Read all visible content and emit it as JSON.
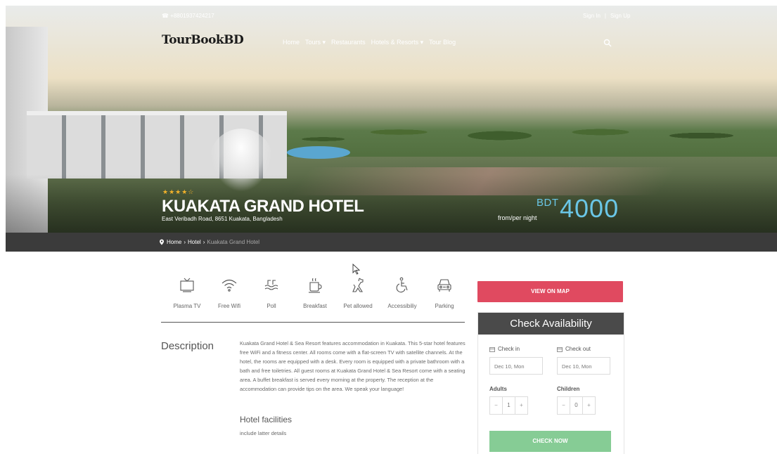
{
  "header": {
    "phone": "☎ +8801937424217",
    "sign_in": "Sign In",
    "separator": "|",
    "sign_up": "Sign Up",
    "brand": "TourBookBD",
    "nav": [
      "Home",
      "Tours ▾",
      "Restaurants",
      "Hotels & Resorts ▾",
      "Tour Blog"
    ]
  },
  "hotel": {
    "stars": "★★★★☆",
    "rating": 4,
    "name": "KUAKATA GRAND HOTEL",
    "address": "East Veribadh Road, 8651 Kuakata, Bangladesh",
    "price_label": "from/per night",
    "currency": "BDT",
    "price": "4000"
  },
  "breadcrumb": {
    "home": "Home",
    "sep": "›",
    "hotel": "Hotel",
    "current": "Kuakata Grand Hotel"
  },
  "amenities": [
    {
      "label": "Plasma TV",
      "icon": "tv-icon"
    },
    {
      "label": "Free Wifi",
      "icon": "wifi-icon"
    },
    {
      "label": "Poll",
      "icon": "pool-icon"
    },
    {
      "label": "Breakfast",
      "icon": "coffee-icon"
    },
    {
      "label": "Pet allowed",
      "icon": "dog-icon"
    },
    {
      "label": "Accessibiliy",
      "icon": "wheelchair-icon"
    },
    {
      "label": "Parking",
      "icon": "car-icon"
    }
  ],
  "description": {
    "heading": "Description",
    "text": "Kuakata Grand Hotel & Sea Resort features accommodation in Kuakata. This 5-star hotel features free WiFi and a fitness center. All rooms come with a flat-screen TV with satellite channels. At the hotel, the rooms are equipped with a desk. Every room is equipped with a private bathroom with a bath and free toiletries. All guest rooms at Kuakata Grand Hotel & Sea Resort come with a seating area. A buffet breakfast is served every morning at the property. The reception at the accommodation can provide tips on the area. We speak your language!",
    "facilities_heading": "Hotel facilities",
    "facilities_text": "include latter details"
  },
  "sidebar": {
    "map_button": "VIEW ON MAP",
    "availability_title": "Check Availability",
    "check_in_label": "Check in",
    "check_out_label": "Check out",
    "check_in_value": "Dec 10, Mon",
    "check_out_value": "Dec 10, Mon",
    "adults_label": "Adults",
    "children_label": "Children",
    "adults_value": "1",
    "children_value": "0",
    "minus": "−",
    "plus": "+",
    "check_button": "CHECK NOW"
  },
  "colors": {
    "map_button": "#e04a60",
    "check_button": "#86cc95",
    "price": "#6ac6e6",
    "breadcrumb_bar": "#3b3b3b",
    "availability_head": "#4a4a4a"
  }
}
